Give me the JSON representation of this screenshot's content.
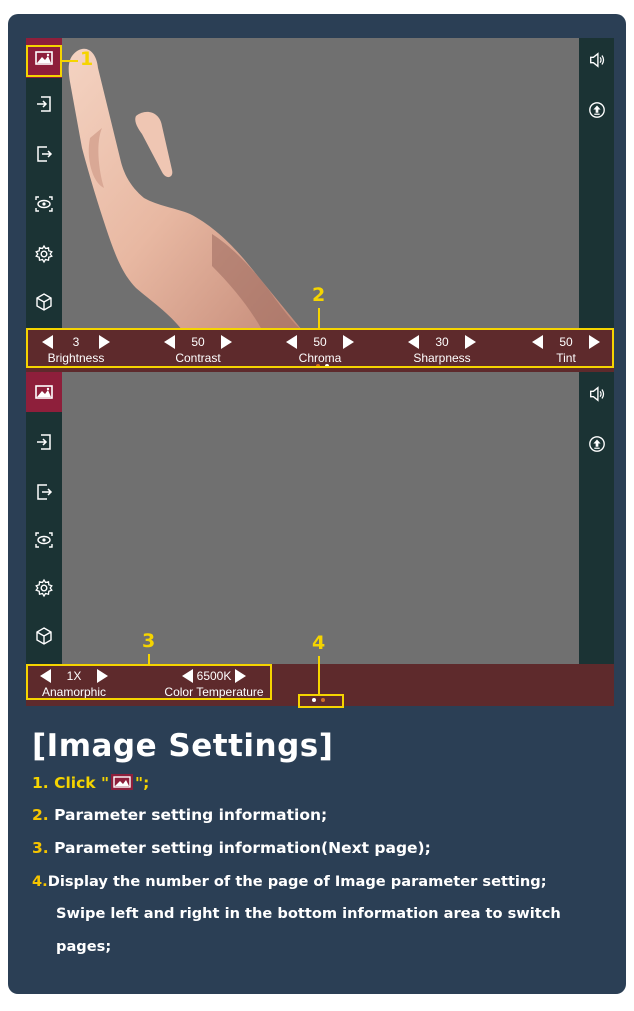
{
  "screen1": {
    "callout_1": "1",
    "callout_2": "2",
    "params": [
      {
        "value": "3",
        "label": "Brightness"
      },
      {
        "value": "50",
        "label": "Contrast"
      },
      {
        "value": "50",
        "label": "Chroma"
      },
      {
        "value": "30",
        "label": "Sharpness"
      },
      {
        "value": "50",
        "label": "Tint"
      }
    ]
  },
  "screen2": {
    "callout_3": "3",
    "callout_4": "4",
    "params": [
      {
        "value": "1X",
        "label": "Anamorphic"
      },
      {
        "value": "6500K",
        "label": "Color Temperature"
      }
    ]
  },
  "sidebar_icons": [
    "image-icon",
    "input-icon",
    "exit-icon",
    "eye-icon",
    "gear-icon",
    "cube-icon"
  ],
  "rightbar_icons": [
    "speaker-icon",
    "upload-icon"
  ],
  "colors": {
    "background": "#2b3f55",
    "accent_yellow": "#f5d400",
    "active_tab": "#8e1f3b",
    "info_bar": "#5e2a2c",
    "stage": "#707070"
  },
  "text": {
    "heading": "[Image Settings]",
    "step1_prefix": "1. Click \"",
    "step1_suffix": "\";",
    "step2_num": "2.",
    "step2": "Parameter setting information;",
    "step3_num": "3.",
    "step3": "Parameter setting information(Next page);",
    "step4_num": "4.",
    "step4_line1": "Display the number of the page of Image parameter setting;",
    "step4_line2": "Swipe left and right in the bottom information area to switch",
    "step4_line3": "pages;"
  }
}
